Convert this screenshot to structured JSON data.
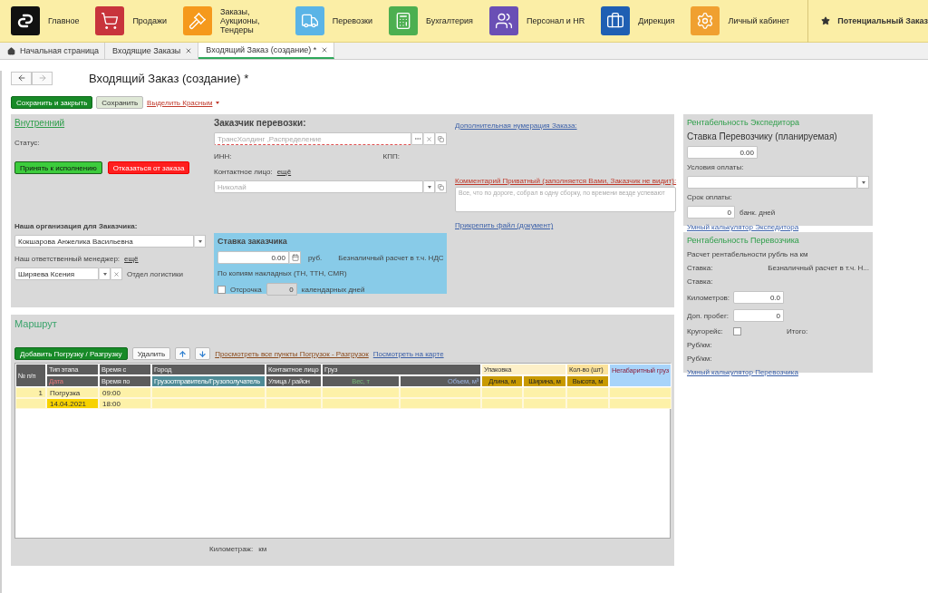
{
  "top_menu": [
    {
      "label": "Главное",
      "kind": "logo",
      "color": "#111111"
    },
    {
      "label": "Продажи",
      "kind": "cart",
      "color": "#c8343c"
    },
    {
      "label": "Заказы, Аукционы, Тендеры",
      "kind": "gavel",
      "color": "#f5991c"
    },
    {
      "label": "Перевозки",
      "kind": "truck",
      "color": "#5ab4e6"
    },
    {
      "label": "Бухгалтерия",
      "kind": "calculator",
      "color": "#4caf50"
    },
    {
      "label": "Персонал и HR",
      "kind": "people",
      "color": "#6a4fb5"
    },
    {
      "label": "Дирекция",
      "kind": "briefcase",
      "color": "#1f5fb3"
    },
    {
      "label": "Личный кабинет",
      "kind": "gear",
      "color": "#f0a030"
    }
  ],
  "favorite": {
    "label": "Потенциальный Заказ"
  },
  "tabs": [
    {
      "label": "Начальная страница",
      "kind": "home",
      "selected": false
    },
    {
      "label": "Входящие Заказы",
      "kind": "closable",
      "selected": false
    },
    {
      "label": "Входящий Заказ (создание) *",
      "kind": "closable",
      "selected": true
    }
  ],
  "form": {
    "title": "Входящий Заказ (создание) *",
    "save_close": "Сохранить и закрыть",
    "save": "Сохранить",
    "highlight": "Выделить Красным"
  },
  "general": {
    "type_link": "Внутренний",
    "status_label": "Статус:",
    "accept": "Принять к исполнению",
    "decline": "Отказаться от заказа",
    "org_label": "Наша организация для Заказчика:",
    "org_value": "Кокшарова Анжелика Васильевна",
    "manager_label": "Наш ответственный менеджер:",
    "manager_more": "ещё",
    "manager_value": "Ширяева Ксения",
    "department": "Отдел логистики"
  },
  "customer": {
    "label": "Заказчик перевозки:",
    "placeholder": "ТрансХолдинг ,Распределение",
    "inn_label": "ИНН:",
    "kpp_label": "КПП:",
    "contact_label": "Контактное лицо:",
    "contact_more": "ещё",
    "contact_placeholder": "Николай"
  },
  "rate": {
    "title": "Ставка заказчика",
    "amount": "0.00",
    "currency": "руб.",
    "payment": "Безналичный расчет в т.ч. НДС",
    "documents": "По копиям накладных (ТН, ТТН, CMR)",
    "deferral": {
      "label": "Отсрочка",
      "checked": false,
      "days": "0",
      "disabled": true,
      "unit": "календарных дней"
    }
  },
  "notes": {
    "numbering_link": "Дополнительная нумерация Заказа:",
    "comment_label": "Комментарий Приватный (заполняется Вами, Заказчик не видит):",
    "comment_placeholder": "Все, что по дороге, собрал в одну сборку, по времени везде успевают",
    "attach_link": "Прикрепить файл (документ)"
  },
  "forwarder": {
    "title": "Рентабельность Экспедитора",
    "subtitle": "Ставка Перевозчику (планируемая)",
    "rate": "0.00",
    "terms_label": "Условия оплаты:",
    "term_label": "Срок оплаты:",
    "term_days": "0",
    "term_unit": "банк. дней",
    "calculator_link": "Умный калькулятор Экспедитора"
  },
  "carrier": {
    "title": "Рентабельность Перевозчика",
    "subtitle": "Расчет рентабельности рубль на км",
    "rate_label": "Ставка:",
    "rate_payment": "Безналичный расчет в т.ч. Н...",
    "rate2_label": "Ставка:",
    "km_label": "Километров:",
    "km": "0.0",
    "extra_label": "Доп. пробег:",
    "extra": "0",
    "round_trip": {
      "label": "Кругорейс:",
      "checked": false
    },
    "total_label": "Итого:",
    "per_km_labels": [
      "Руб/км:",
      "Руб/км:"
    ],
    "calculator_link": "Умный калькулятор Перевозчика"
  },
  "route": {
    "title": "Маршрут",
    "add": "Добавить Погрузку / Разгрузку",
    "delete": "Удалить",
    "view_all_link": "Просмотреть все пункты Погрузок - Разгрузок",
    "map_link": "Посмотреть на карте",
    "header": [
      {
        "label": "№ п/п",
        "kind": "dark"
      },
      {
        "label": "Тип этапа",
        "kind": "dark"
      },
      {
        "label": "Время с",
        "kind": "dark"
      },
      {
        "label": "Город",
        "kind": "dark"
      },
      {
        "label": "Контактное лицо",
        "kind": "dark"
      },
      {
        "label": "Груз",
        "kind": "dark"
      },
      {
        "label": "Упаковка",
        "kind": "pack"
      },
      {
        "label": "Кол-во (шт)",
        "kind": "qty"
      },
      {
        "label": "Негабаритный груз",
        "kind": "oversize"
      },
      {
        "label": "Дата",
        "kind": "date"
      },
      {
        "label": "Время по",
        "kind": "dark"
      },
      {
        "label": "Грузоотправитель/Грузополучатель",
        "kind": "teal"
      },
      {
        "label": "Улица / район",
        "kind": "dark"
      },
      {
        "label": "Вес, т",
        "kind": "weight"
      },
      {
        "label": "Объем, м³",
        "kind": "volume"
      },
      {
        "label": "Длина, м",
        "kind": "size"
      },
      {
        "label": "Ширина, м",
        "kind": "size"
      },
      {
        "label": "Высота, м",
        "kind": "size"
      }
    ],
    "points": [
      {
        "number": "1",
        "stage_type": "Погрузка",
        "time_from": "09:00",
        "date": "14.04.2021",
        "date_selected": true,
        "time_to": "18:00"
      }
    ],
    "mileage_label": "Километраж:",
    "mileage_unit": "км"
  }
}
